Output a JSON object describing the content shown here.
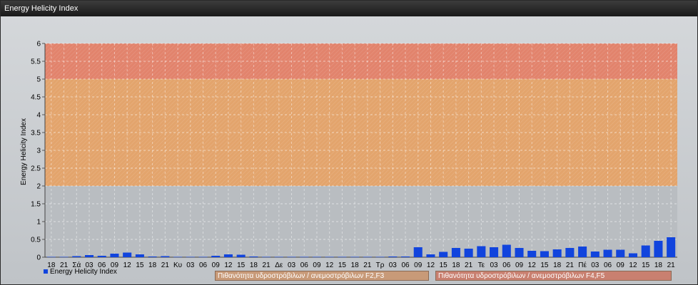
{
  "window": {
    "title": "Energy Helicity Index"
  },
  "legend": {
    "series_label": "Energy Helicity Index"
  },
  "bands": [
    {
      "label": "Πιθανότητα υδροστρόβιλων / ανεμοστρόβιλων F2,F3",
      "from": 2,
      "to": 5,
      "color": "#e3a46c"
    },
    {
      "label": "Πιθανότητα υδροστρόβιλων / ανεμοστρόβιλων F4,F5",
      "from": 5,
      "to": 6,
      "color": "#e2836c"
    }
  ],
  "chart_data": {
    "type": "bar",
    "title": "",
    "xlabel": "",
    "ylabel": "Energy Helicity Index",
    "ylim": [
      0,
      6
    ],
    "yticks": [
      0,
      0.5,
      1,
      1.5,
      2,
      2.5,
      3,
      3.5,
      4,
      4.5,
      5,
      5.5,
      6
    ],
    "grid": true,
    "legend_position": "bottom-left",
    "bar_color": "#1144dd",
    "categories": [
      "18",
      "21",
      "Σά",
      "03",
      "06",
      "09",
      "12",
      "15",
      "18",
      "21",
      "Κυ",
      "03",
      "06",
      "09",
      "12",
      "15",
      "18",
      "21",
      "Δε",
      "03",
      "06",
      "09",
      "12",
      "15",
      "18",
      "21",
      "Τρ",
      "03",
      "06",
      "09",
      "12",
      "15",
      "18",
      "21",
      "Τε",
      "03",
      "06",
      "09",
      "12",
      "15",
      "18",
      "21",
      "Πέ",
      "03",
      "06",
      "09",
      "12",
      "15",
      "18",
      "21"
    ],
    "series": [
      {
        "name": "Energy Helicity Index",
        "values": [
          0.01,
          0.01,
          0.03,
          0.06,
          0.04,
          0.1,
          0.13,
          0.08,
          0.02,
          0.03,
          0.01,
          0.01,
          0.01,
          0.04,
          0.08,
          0.07,
          0.02,
          0.01,
          0.01,
          0.01,
          0.01,
          0.01,
          0.01,
          0.01,
          0.01,
          0.01,
          0.01,
          0.02,
          0.02,
          0.28,
          0.08,
          0.15,
          0.26,
          0.24,
          0.31,
          0.28,
          0.35,
          0.26,
          0.18,
          0.17,
          0.22,
          0.26,
          0.3,
          0.16,
          0.21,
          0.21,
          0.11,
          0.33,
          0.46,
          0.56
        ]
      }
    ]
  }
}
